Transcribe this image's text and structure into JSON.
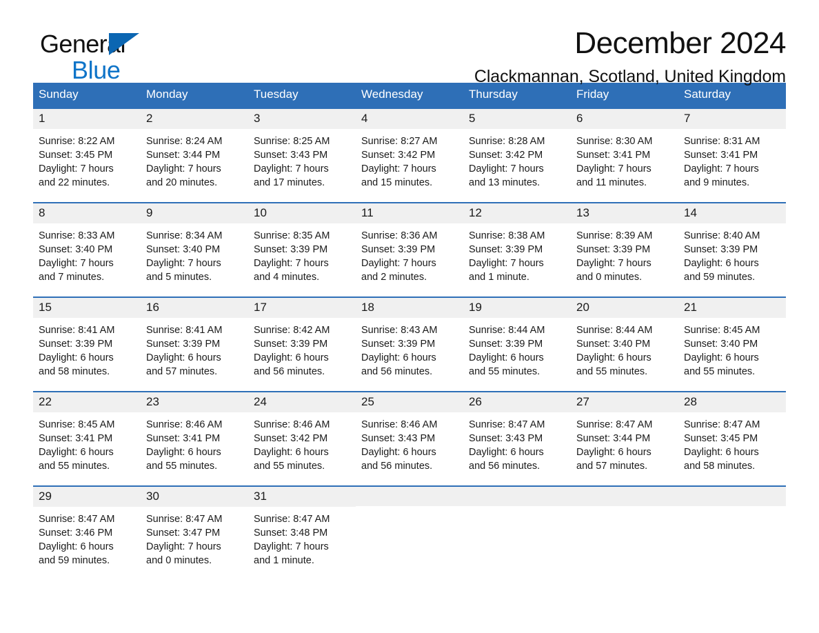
{
  "brand": {
    "word1": "General",
    "word2": "Blue",
    "triangle_color": "#0b66b2",
    "blue_text_color": "#0f74c8"
  },
  "header": {
    "month_title": "December 2024",
    "location": "Clackmannan, Scotland, United Kingdom"
  },
  "theme": {
    "header_blue": "#2e6fb7",
    "daynum_band": "#f0f0f0",
    "text": "#1a1a1a"
  },
  "weekday_headers": [
    "Sunday",
    "Monday",
    "Tuesday",
    "Wednesday",
    "Thursday",
    "Friday",
    "Saturday"
  ],
  "labels": {
    "sunrise_prefix": "Sunrise:",
    "sunset_prefix": "Sunset:",
    "daylight_prefix": "Daylight:"
  },
  "weeks": [
    [
      {
        "day": "1",
        "sunrise": "Sunrise: 8:22 AM",
        "sunset": "Sunset: 3:45 PM",
        "daylight_line1": "Daylight: 7 hours",
        "daylight_line2": "and 22 minutes."
      },
      {
        "day": "2",
        "sunrise": "Sunrise: 8:24 AM",
        "sunset": "Sunset: 3:44 PM",
        "daylight_line1": "Daylight: 7 hours",
        "daylight_line2": "and 20 minutes."
      },
      {
        "day": "3",
        "sunrise": "Sunrise: 8:25 AM",
        "sunset": "Sunset: 3:43 PM",
        "daylight_line1": "Daylight: 7 hours",
        "daylight_line2": "and 17 minutes."
      },
      {
        "day": "4",
        "sunrise": "Sunrise: 8:27 AM",
        "sunset": "Sunset: 3:42 PM",
        "daylight_line1": "Daylight: 7 hours",
        "daylight_line2": "and 15 minutes."
      },
      {
        "day": "5",
        "sunrise": "Sunrise: 8:28 AM",
        "sunset": "Sunset: 3:42 PM",
        "daylight_line1": "Daylight: 7 hours",
        "daylight_line2": "and 13 minutes."
      },
      {
        "day": "6",
        "sunrise": "Sunrise: 8:30 AM",
        "sunset": "Sunset: 3:41 PM",
        "daylight_line1": "Daylight: 7 hours",
        "daylight_line2": "and 11 minutes."
      },
      {
        "day": "7",
        "sunrise": "Sunrise: 8:31 AM",
        "sunset": "Sunset: 3:41 PM",
        "daylight_line1": "Daylight: 7 hours",
        "daylight_line2": "and 9 minutes."
      }
    ],
    [
      {
        "day": "8",
        "sunrise": "Sunrise: 8:33 AM",
        "sunset": "Sunset: 3:40 PM",
        "daylight_line1": "Daylight: 7 hours",
        "daylight_line2": "and 7 minutes."
      },
      {
        "day": "9",
        "sunrise": "Sunrise: 8:34 AM",
        "sunset": "Sunset: 3:40 PM",
        "daylight_line1": "Daylight: 7 hours",
        "daylight_line2": "and 5 minutes."
      },
      {
        "day": "10",
        "sunrise": "Sunrise: 8:35 AM",
        "sunset": "Sunset: 3:39 PM",
        "daylight_line1": "Daylight: 7 hours",
        "daylight_line2": "and 4 minutes."
      },
      {
        "day": "11",
        "sunrise": "Sunrise: 8:36 AM",
        "sunset": "Sunset: 3:39 PM",
        "daylight_line1": "Daylight: 7 hours",
        "daylight_line2": "and 2 minutes."
      },
      {
        "day": "12",
        "sunrise": "Sunrise: 8:38 AM",
        "sunset": "Sunset: 3:39 PM",
        "daylight_line1": "Daylight: 7 hours",
        "daylight_line2": "and 1 minute."
      },
      {
        "day": "13",
        "sunrise": "Sunrise: 8:39 AM",
        "sunset": "Sunset: 3:39 PM",
        "daylight_line1": "Daylight: 7 hours",
        "daylight_line2": "and 0 minutes."
      },
      {
        "day": "14",
        "sunrise": "Sunrise: 8:40 AM",
        "sunset": "Sunset: 3:39 PM",
        "daylight_line1": "Daylight: 6 hours",
        "daylight_line2": "and 59 minutes."
      }
    ],
    [
      {
        "day": "15",
        "sunrise": "Sunrise: 8:41 AM",
        "sunset": "Sunset: 3:39 PM",
        "daylight_line1": "Daylight: 6 hours",
        "daylight_line2": "and 58 minutes."
      },
      {
        "day": "16",
        "sunrise": "Sunrise: 8:41 AM",
        "sunset": "Sunset: 3:39 PM",
        "daylight_line1": "Daylight: 6 hours",
        "daylight_line2": "and 57 minutes."
      },
      {
        "day": "17",
        "sunrise": "Sunrise: 8:42 AM",
        "sunset": "Sunset: 3:39 PM",
        "daylight_line1": "Daylight: 6 hours",
        "daylight_line2": "and 56 minutes."
      },
      {
        "day": "18",
        "sunrise": "Sunrise: 8:43 AM",
        "sunset": "Sunset: 3:39 PM",
        "daylight_line1": "Daylight: 6 hours",
        "daylight_line2": "and 56 minutes."
      },
      {
        "day": "19",
        "sunrise": "Sunrise: 8:44 AM",
        "sunset": "Sunset: 3:39 PM",
        "daylight_line1": "Daylight: 6 hours",
        "daylight_line2": "and 55 minutes."
      },
      {
        "day": "20",
        "sunrise": "Sunrise: 8:44 AM",
        "sunset": "Sunset: 3:40 PM",
        "daylight_line1": "Daylight: 6 hours",
        "daylight_line2": "and 55 minutes."
      },
      {
        "day": "21",
        "sunrise": "Sunrise: 8:45 AM",
        "sunset": "Sunset: 3:40 PM",
        "daylight_line1": "Daylight: 6 hours",
        "daylight_line2": "and 55 minutes."
      }
    ],
    [
      {
        "day": "22",
        "sunrise": "Sunrise: 8:45 AM",
        "sunset": "Sunset: 3:41 PM",
        "daylight_line1": "Daylight: 6 hours",
        "daylight_line2": "and 55 minutes."
      },
      {
        "day": "23",
        "sunrise": "Sunrise: 8:46 AM",
        "sunset": "Sunset: 3:41 PM",
        "daylight_line1": "Daylight: 6 hours",
        "daylight_line2": "and 55 minutes."
      },
      {
        "day": "24",
        "sunrise": "Sunrise: 8:46 AM",
        "sunset": "Sunset: 3:42 PM",
        "daylight_line1": "Daylight: 6 hours",
        "daylight_line2": "and 55 minutes."
      },
      {
        "day": "25",
        "sunrise": "Sunrise: 8:46 AM",
        "sunset": "Sunset: 3:43 PM",
        "daylight_line1": "Daylight: 6 hours",
        "daylight_line2": "and 56 minutes."
      },
      {
        "day": "26",
        "sunrise": "Sunrise: 8:47 AM",
        "sunset": "Sunset: 3:43 PM",
        "daylight_line1": "Daylight: 6 hours",
        "daylight_line2": "and 56 minutes."
      },
      {
        "day": "27",
        "sunrise": "Sunrise: 8:47 AM",
        "sunset": "Sunset: 3:44 PM",
        "daylight_line1": "Daylight: 6 hours",
        "daylight_line2": "and 57 minutes."
      },
      {
        "day": "28",
        "sunrise": "Sunrise: 8:47 AM",
        "sunset": "Sunset: 3:45 PM",
        "daylight_line1": "Daylight: 6 hours",
        "daylight_line2": "and 58 minutes."
      }
    ],
    [
      {
        "day": "29",
        "sunrise": "Sunrise: 8:47 AM",
        "sunset": "Sunset: 3:46 PM",
        "daylight_line1": "Daylight: 6 hours",
        "daylight_line2": "and 59 minutes."
      },
      {
        "day": "30",
        "sunrise": "Sunrise: 8:47 AM",
        "sunset": "Sunset: 3:47 PM",
        "daylight_line1": "Daylight: 7 hours",
        "daylight_line2": "and 0 minutes."
      },
      {
        "day": "31",
        "sunrise": "Sunrise: 8:47 AM",
        "sunset": "Sunset: 3:48 PM",
        "daylight_line1": "Daylight: 7 hours",
        "daylight_line2": "and 1 minute."
      },
      {
        "day": "",
        "sunrise": "",
        "sunset": "",
        "daylight_line1": "",
        "daylight_line2": ""
      },
      {
        "day": "",
        "sunrise": "",
        "sunset": "",
        "daylight_line1": "",
        "daylight_line2": ""
      },
      {
        "day": "",
        "sunrise": "",
        "sunset": "",
        "daylight_line1": "",
        "daylight_line2": ""
      },
      {
        "day": "",
        "sunrise": "",
        "sunset": "",
        "daylight_line1": "",
        "daylight_line2": ""
      }
    ]
  ]
}
